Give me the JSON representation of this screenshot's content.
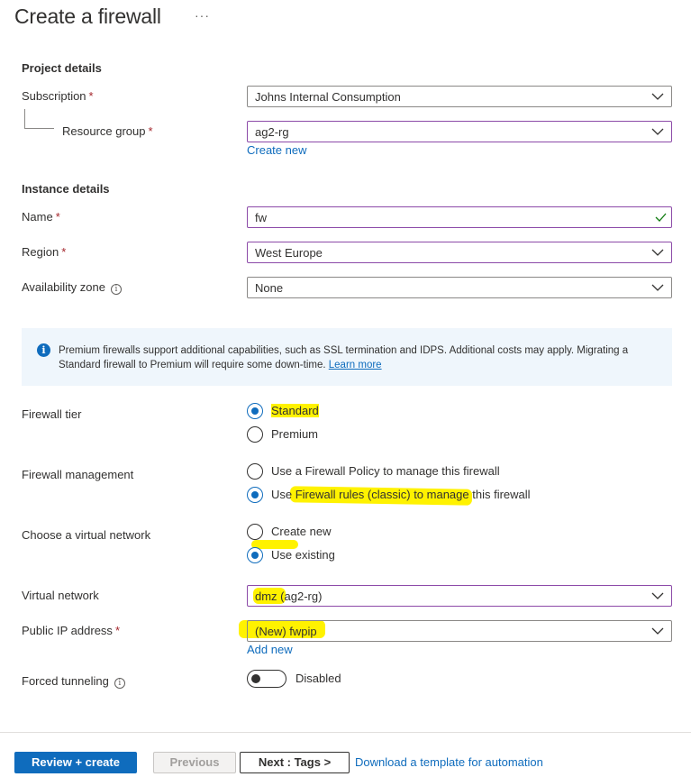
{
  "page": {
    "title": "Create a firewall",
    "more": "···"
  },
  "project": {
    "heading": "Project details",
    "subscription": {
      "label": "Subscription",
      "required": "*",
      "value": "Johns Internal Consumption"
    },
    "resource_group": {
      "label": "Resource group",
      "required": "*",
      "value": "ag2-rg",
      "create_new": "Create new"
    }
  },
  "instance": {
    "heading": "Instance details",
    "name": {
      "label": "Name",
      "required": "*",
      "value": "fw"
    },
    "region": {
      "label": "Region",
      "required": "*",
      "value": "West Europe"
    },
    "availability_zone": {
      "label": "Availability zone",
      "info": "i",
      "value": "None"
    }
  },
  "banner": {
    "icon": "i",
    "text": "Premium firewalls support additional capabilities, such as SSL termination and IDPS. Additional costs may apply. Migrating a Standard firewall to Premium will require some down-time.",
    "link": "Learn more"
  },
  "firewall_tier": {
    "label": "Firewall tier",
    "options": [
      "Standard",
      "Premium"
    ],
    "selected": "Standard"
  },
  "firewall_management": {
    "label": "Firewall management",
    "options": [
      "Use a Firewall Policy to manage this firewall",
      "Use Firewall rules (classic) to manage this firewall"
    ],
    "selected": "Use Firewall rules (classic) to manage this firewall"
  },
  "virtual_network_choice": {
    "label": "Choose a virtual network",
    "options": [
      "Create new",
      "Use existing"
    ],
    "selected": "Use existing"
  },
  "virtual_network": {
    "label": "Virtual network",
    "value": "dmz (ag2-rg)"
  },
  "public_ip": {
    "label": "Public IP address",
    "required": "*",
    "value": "(New) fwpip",
    "add_new": "Add new"
  },
  "forced_tunneling": {
    "label": "Forced tunneling",
    "info": "i",
    "state": "Disabled"
  },
  "footer": {
    "review_create": "Review + create",
    "previous": "Previous",
    "next": "Next : Tags >",
    "download": "Download a template for automation"
  },
  "colors": {
    "accent": "#0f6cbd",
    "focus_border": "#8c4aa8",
    "required": "#a4262c",
    "highlight": "#fff200",
    "valid": "#107c10"
  }
}
